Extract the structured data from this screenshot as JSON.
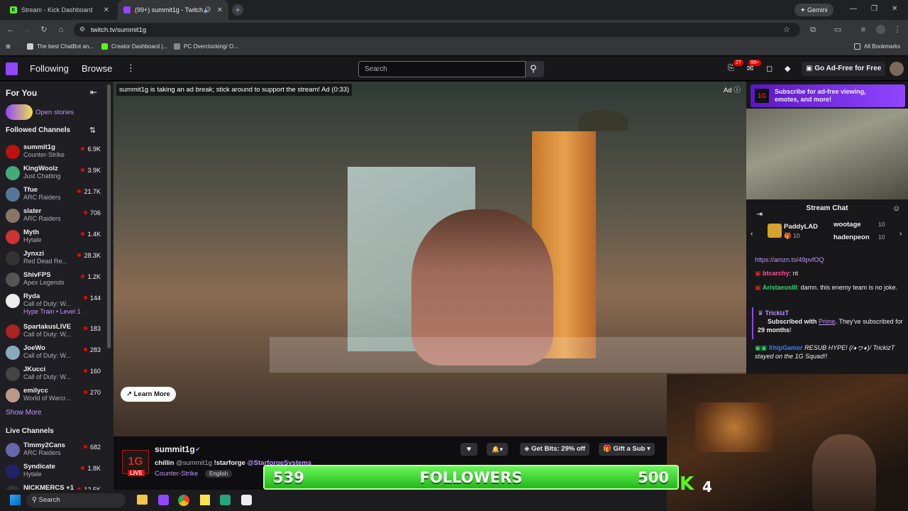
{
  "browser": {
    "tabs": [
      {
        "title": "Stream - Kick Dashboard",
        "fav_color": "#53fc18",
        "fav_letter": "K"
      },
      {
        "title": "(99+) summit1g - Twitch",
        "fav_color": "#9146ff",
        "fav_letter": ""
      }
    ],
    "new_tab": "+",
    "profile_button": "Gemini",
    "url": "twitch.tv/summit1g",
    "bookmarks": [
      "The best ChatBot an...",
      "Creator Dashboard |...",
      "PC Overclocking/ O..."
    ],
    "all_bookmarks": "All Bookmarks"
  },
  "twitch_nav": {
    "following": "Following",
    "browse": "Browse",
    "search_placeholder": "Search",
    "badge_inbox": "27",
    "badge_notifications": "99+",
    "ad_free": "Go Ad-Free for Free"
  },
  "sidebar": {
    "for_you": "For You",
    "open_stories": "Open stories",
    "followed_title": "Followed Channels",
    "followed": [
      {
        "name": "summit1g",
        "game": "Counter-Strike",
        "viewers": "6.9K",
        "color": "#b11"
      },
      {
        "name": "KingWoolz",
        "game": "Just Chatting",
        "viewers": "3.9K",
        "color": "#4a7"
      },
      {
        "name": "Tfue",
        "game": "ARC Raiders",
        "viewers": "21.7K",
        "color": "#579"
      },
      {
        "name": "slater",
        "game": "ARC Raiders",
        "viewers": "706",
        "color": "#876"
      },
      {
        "name": "Myth",
        "game": "Hytale",
        "viewers": "1.4K",
        "color": "#c33"
      },
      {
        "name": "Jynxzi",
        "game": "Red Dead Re...",
        "viewers": "28.3K",
        "color": "#333"
      },
      {
        "name": "ShivFPS",
        "game": "Apex Legends",
        "viewers": "1.2K",
        "color": "#555"
      },
      {
        "name": "Ryda",
        "game": "Call of Duty: W...",
        "viewers": "144",
        "color": "#eee",
        "extra": "Hype Train • Level 1"
      },
      {
        "name": "SpartakusLIVE",
        "game": "Call of Duty: W...",
        "viewers": "183",
        "color": "#a22"
      },
      {
        "name": "JoeWo",
        "game": "Call of Duty: W...",
        "viewers": "283",
        "color": "#8ab"
      },
      {
        "name": "JKucci",
        "game": "Call of Duty: W...",
        "viewers": "160",
        "color": "#444"
      },
      {
        "name": "emilycc",
        "game": "World of Warcr...",
        "viewers": "270",
        "color": "#b98"
      }
    ],
    "show_more": "Show More",
    "live_title": "Live Channels",
    "live": [
      {
        "name": "Timmy2Cans",
        "game": "ARC Raiders",
        "viewers": "682",
        "color": "#66a"
      },
      {
        "name": "Syndicate",
        "game": "Hytale",
        "viewers": "1.8K",
        "color": "#226"
      },
      {
        "name": "NICKMERCS +1",
        "game": "",
        "viewers": "12.5K",
        "color": "#333"
      }
    ]
  },
  "video": {
    "ad_banner": "summit1g is taking an ad break; stick around to support the stream! Ad (0:33)",
    "ad_label": "Ad",
    "learn_more": "Learn More"
  },
  "stream_info": {
    "channel": "summit1g",
    "live": "LIVE",
    "title_prefix": "chillin",
    "title_mention": "@summit1g",
    "title_cmd": "!starforge",
    "title_sponsor": "@StarforgeSystems",
    "category": "Counter-Strike",
    "language": "English",
    "get_bits": "Get Bits: 29% off",
    "gift_sub": "Gift a Sub"
  },
  "chat": {
    "promo": "Subscribe for ad-free viewing, emotes, and more!",
    "header": "Stream Chat",
    "gifters": [
      {
        "name": "PaddyLAD",
        "count": "10"
      },
      {
        "name": "wootage",
        "count": "10"
      },
      {
        "name": "hadenpeon",
        "count": "10"
      }
    ],
    "link": "https://amzn.to/49pvfOQ",
    "msg1_user": "btcarchy",
    "msg1_text": ": nt",
    "msg2_user": "AristaeusIII",
    "msg2_text": ": damn. this enemy team is no joke.",
    "sub_user": "TrickizT",
    "sub_text_a": "Subscribed with",
    "sub_prime": "Prime",
    "sub_text_b": ". They've subscribed for",
    "sub_months": "29 months",
    "sub_end": "!",
    "hype_user": "XhipGamer",
    "hype_text": "RESUB HYPE! (/◕ヮ◕)/ TrickizT stayed on the 1G Squad!!"
  },
  "overlay": {
    "followers_count": "539",
    "followers_label": "FOLLOWERS",
    "followers_goal": "500",
    "kick_viewers": "4"
  },
  "taskbar": {
    "search": "Search"
  }
}
